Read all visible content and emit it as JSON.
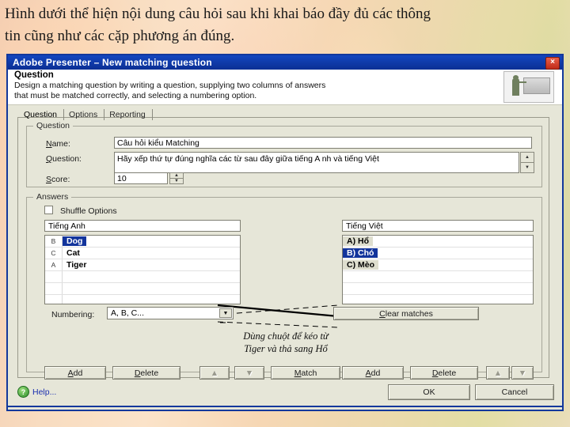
{
  "slide": {
    "heading_lines": [
      "Hình dưới thể hiện nội dung câu hỏi sau khi khai báo đầy đủ các thông",
      "tin cũng như các cặp phương án đúng."
    ]
  },
  "dialog": {
    "title": "Adobe Presenter – New matching question",
    "close_label": "×",
    "banner": {
      "title": "Question",
      "desc_lines": [
        "Design a matching question by writing a question, supplying two columns of answers",
        "that must be matched correctly, and selecting a numbering option."
      ],
      "icon": "presenter-board-icon"
    },
    "tabs": [
      {
        "label": "Question",
        "active": true
      },
      {
        "label": "Options",
        "active": false
      },
      {
        "label": "Reporting",
        "active": false
      }
    ],
    "question_group": {
      "legend": "Question",
      "name_label": "Name:",
      "name_value": "Câu hỏi kiểu Matching",
      "question_label": "Question:",
      "question_value": "Hãy xếp thứ tự đúng nghĩa các từ sau đây giữa tiếng A nh và tiếng Việt",
      "score_label": "Score:",
      "score_value": "10",
      "spinner_up": "▲",
      "spinner_down": "▼"
    },
    "answers_group": {
      "legend": "Answers",
      "shuffle_label": "Shuffle Options",
      "shuffle_checked": false,
      "left_column": {
        "header": "Tiếng Anh",
        "items": [
          {
            "prefix": "B",
            "text": "Dog",
            "state": "selected"
          },
          {
            "prefix": "C",
            "text": "Cat",
            "state": "normal"
          },
          {
            "prefix": "A",
            "text": "Tiger",
            "state": "normal"
          }
        ]
      },
      "right_column": {
        "header": "Tiếng Việt",
        "items": [
          {
            "text": "A) Hổ",
            "state": "shaded"
          },
          {
            "text": "B) Chó",
            "state": "selected"
          },
          {
            "text": "C) Mèo",
            "state": "shaded"
          }
        ]
      },
      "left_buttons": [
        {
          "label": "Add",
          "name": "left-add-button",
          "enabled": true
        },
        {
          "label": "Delete",
          "name": "left-delete-button",
          "enabled": true
        },
        {
          "label": "▲",
          "name": "left-move-up-button",
          "enabled": false
        },
        {
          "label": "▼",
          "name": "left-move-down-button",
          "enabled": false
        },
        {
          "label": "Match",
          "name": "match-button",
          "enabled": true
        }
      ],
      "right_buttons": [
        {
          "label": "Add",
          "name": "right-add-button",
          "enabled": true
        },
        {
          "label": "Delete",
          "name": "right-delete-button",
          "enabled": true
        },
        {
          "label": "▲",
          "name": "right-move-up-button",
          "enabled": false
        },
        {
          "label": "▼",
          "name": "right-move-down-button",
          "enabled": false
        }
      ],
      "numbering_label": "Numbering:",
      "numbering_value": "A, B, C...",
      "numbering_arrow": "▼",
      "clear_matches_label": "Clear matches"
    },
    "annotation": {
      "line1": "Dùng chuột để kéo từ",
      "line2": "Tiger và thả sang Hổ"
    },
    "footer": {
      "help_label": "Help...",
      "help_icon": "?",
      "ok_label": "OK",
      "cancel_label": "Cancel"
    },
    "colors": {
      "titlebar": "#0b2f94",
      "dialog_border": "#13389c",
      "face": "#e6e6d8",
      "selection": "#12349c",
      "link": "#1a2fb0"
    }
  }
}
